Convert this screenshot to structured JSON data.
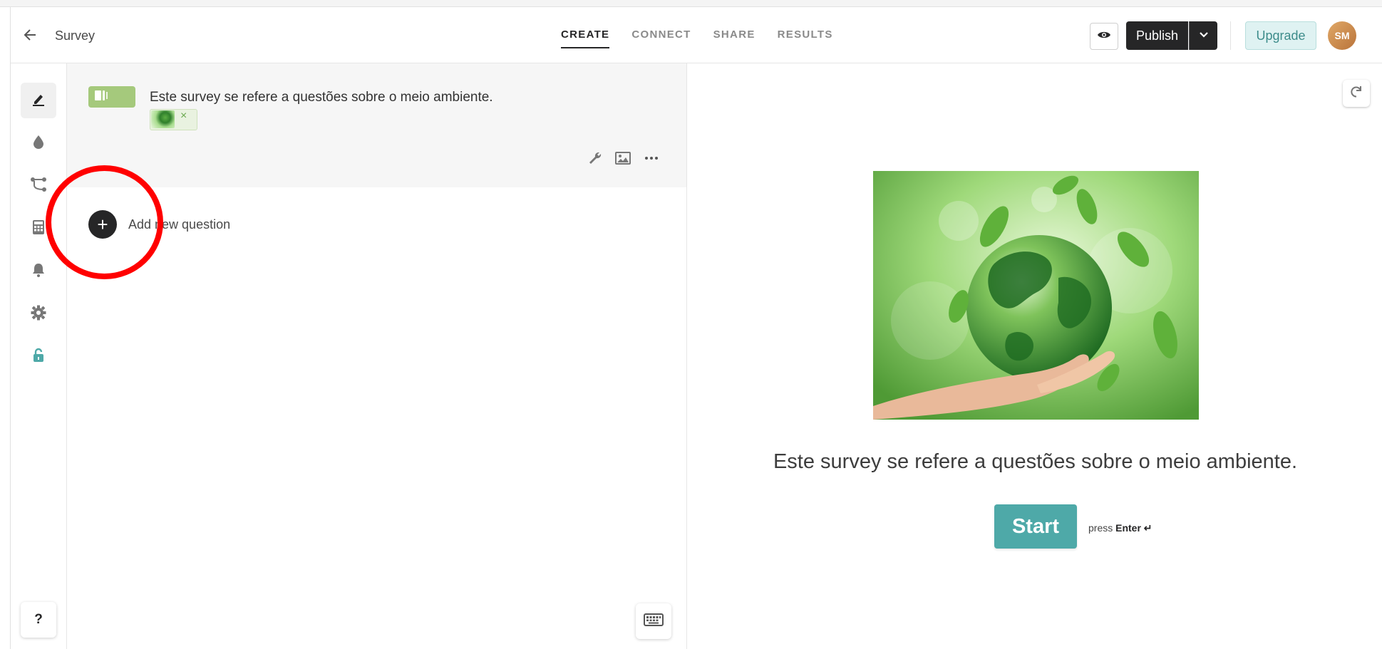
{
  "header": {
    "back_icon": "arrow-left-icon",
    "form_title": "Survey",
    "tabs": [
      {
        "label": "CREATE",
        "active": true
      },
      {
        "label": "CONNECT",
        "active": false
      },
      {
        "label": "SHARE",
        "active": false
      },
      {
        "label": "RESULTS",
        "active": false
      }
    ],
    "preview_icon": "eye-icon",
    "publish_label": "Publish",
    "publish_dropdown_icon": "chevron-down-icon",
    "upgrade_label": "Upgrade",
    "avatar_initials": "SM"
  },
  "sidebar": {
    "items": [
      {
        "icon": "pencil-icon",
        "active": true
      },
      {
        "icon": "drop-icon",
        "active": false
      },
      {
        "icon": "logic-flow-icon",
        "active": false
      },
      {
        "icon": "calculator-icon",
        "active": false
      },
      {
        "icon": "bell-icon",
        "active": false
      },
      {
        "icon": "gear-icon",
        "active": false
      },
      {
        "icon": "unlock-icon",
        "active": false
      }
    ],
    "help_label": "?"
  },
  "editor": {
    "welcome_text": "Este survey se refere a questões sobre o meio ambiente.",
    "thumbnail_remove": "×",
    "toolbar_icons": [
      "wrench-icon",
      "image-icon",
      "more-icon"
    ],
    "add_question_label": "Add new question",
    "add_question_icon": "+",
    "keyboard_icon": "keyboard-icon"
  },
  "preview": {
    "refresh_icon": "refresh-icon",
    "welcome_text": "Este survey se refere a questões sobre o meio ambiente.",
    "start_label": "Start",
    "press_label": "press",
    "enter_label": "Enter ↵"
  },
  "colors": {
    "accent": "#4ea9a8",
    "dark": "#262627",
    "badge_green": "#a5c97c",
    "highlight_red": "#ff0000"
  }
}
